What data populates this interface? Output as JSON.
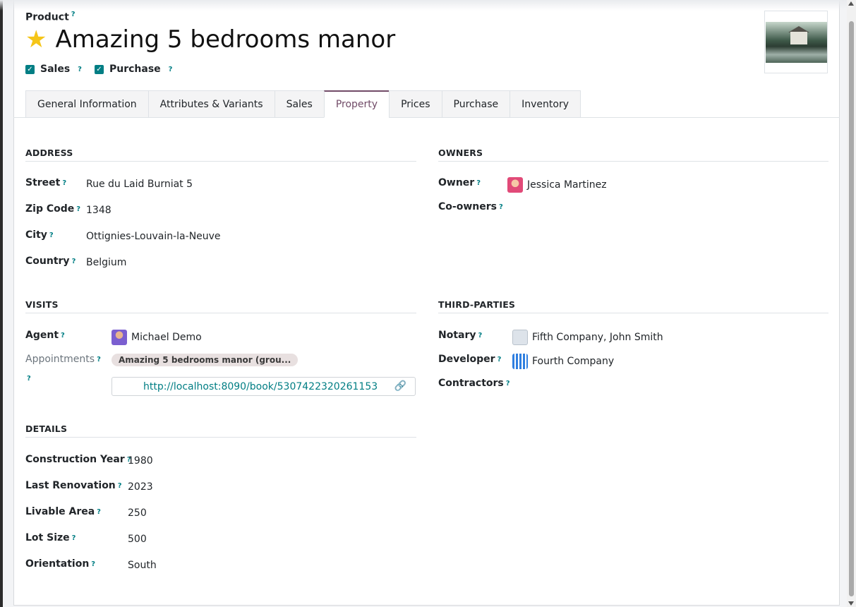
{
  "header": {
    "product_label": "Product",
    "title": "Amazing 5 bedrooms manor",
    "sales_label": "Sales",
    "purchase_label": "Purchase",
    "help_mark": "?"
  },
  "tabs": [
    {
      "label": "General Information"
    },
    {
      "label": "Attributes & Variants"
    },
    {
      "label": "Sales"
    },
    {
      "label": "Property",
      "active": true
    },
    {
      "label": "Prices"
    },
    {
      "label": "Purchase"
    },
    {
      "label": "Inventory"
    }
  ],
  "address": {
    "title": "ADDRESS",
    "street_label": "Street",
    "street": "Rue du Laid Burniat 5",
    "zip_label": "Zip Code",
    "zip": "1348",
    "city_label": "City",
    "city": "Ottignies-Louvain-la-Neuve",
    "country_label": "Country",
    "country": "Belgium"
  },
  "owners": {
    "title": "OWNERS",
    "owner_label": "Owner",
    "owner": "Jessica Martinez",
    "coowners_label": "Co-owners"
  },
  "visits": {
    "title": "VISITS",
    "agent_label": "Agent",
    "agent": "Michael Demo",
    "appointments_label": "Appointments",
    "appointment_tag": "Amazing 5 bedrooms manor (grou...",
    "booking_url": "http://localhost:8090/book/5307422320261153"
  },
  "third_parties": {
    "title": "THIRD-PARTIES",
    "notary_label": "Notary",
    "notary": "Fifth Company, John Smith",
    "developer_label": "Developer",
    "developer": "Fourth Company",
    "contractors_label": "Contractors"
  },
  "details": {
    "title": "DETAILS",
    "year_label": "Construction Year",
    "year": "1980",
    "renovation_label": "Last Renovation",
    "renovation": "2023",
    "area_label": "Livable Area",
    "area": "250",
    "lot_label": "Lot Size",
    "lot": "500",
    "orientation_label": "Orientation",
    "orientation": "South"
  },
  "colors": {
    "accent": "#714b67",
    "teal": "#017e84",
    "star": "#f5c518"
  }
}
